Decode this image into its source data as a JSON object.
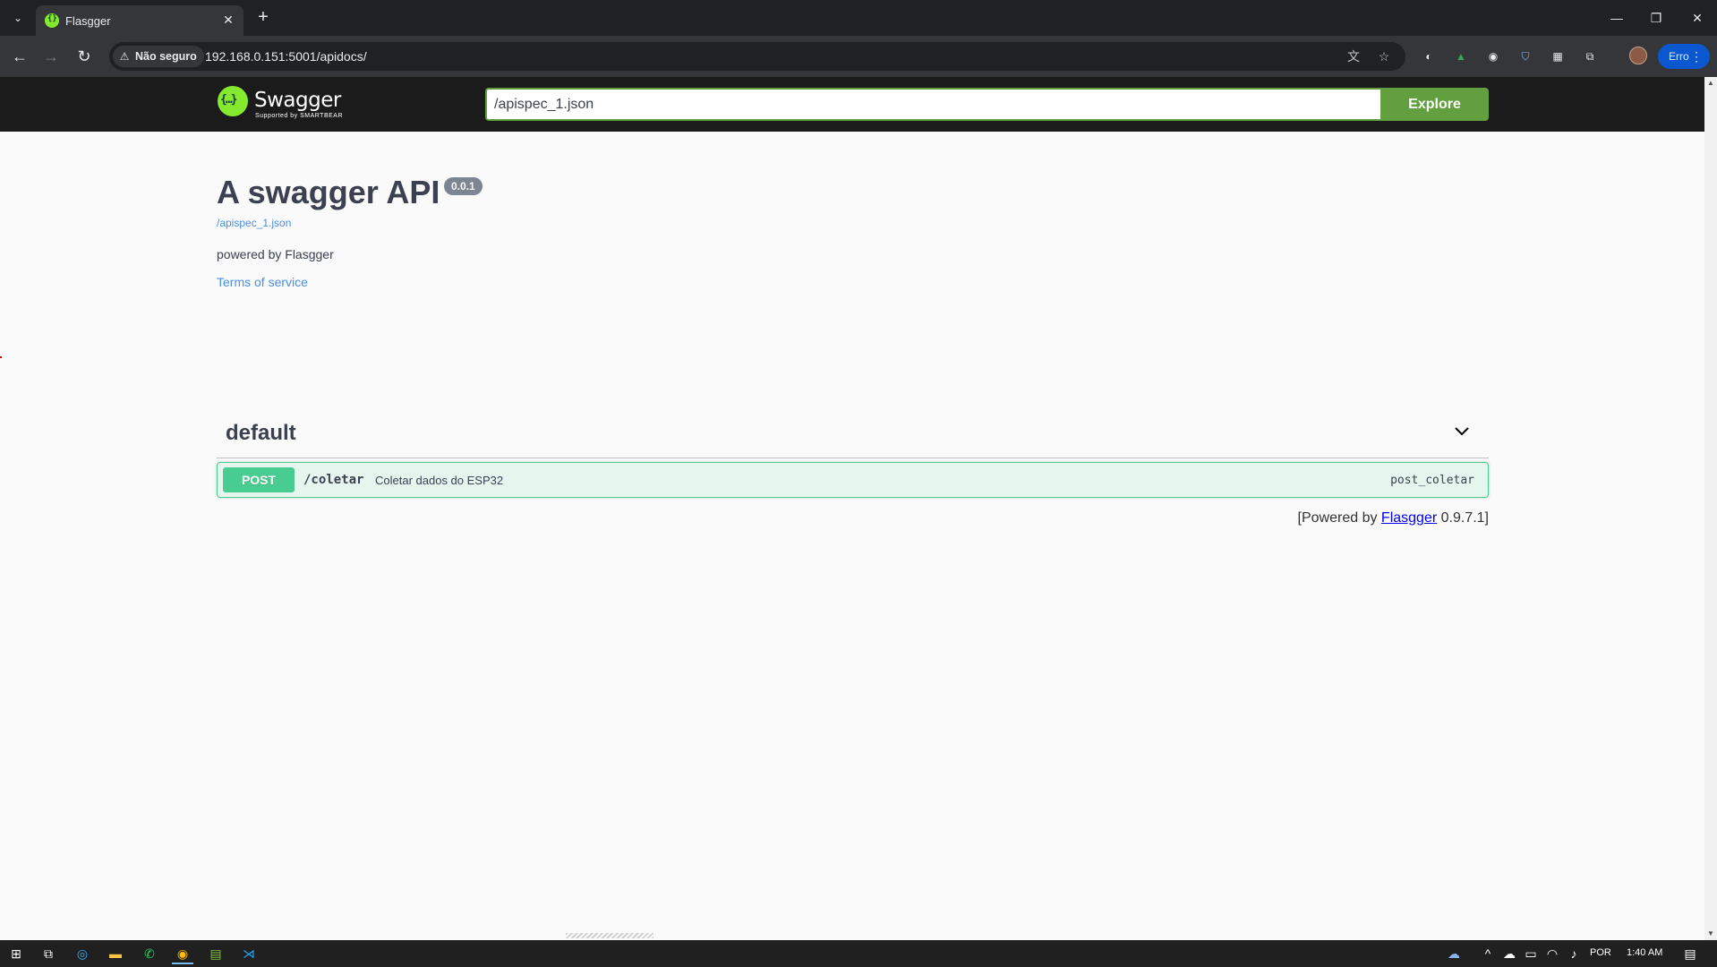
{
  "browser": {
    "tab_title": "Flasgger",
    "security_label": "Não seguro",
    "url": "192.168.0.151:5001/apidocs/",
    "error_chip_label": "Erro"
  },
  "swagger": {
    "brand": "Swagger",
    "brand_sub": "Supported by SMARTBEAR",
    "spec_url_value": "/apispec_1.json",
    "explore_label": "Explore"
  },
  "info": {
    "title": "A swagger API",
    "version": "0.0.1",
    "spec_link": "/apispec_1.json",
    "description": "powered by Flasgger",
    "terms_label": "Terms of service"
  },
  "tags": [
    {
      "name": "default",
      "operations": [
        {
          "method": "POST",
          "path": "/coletar",
          "summary": "Coletar dados do ESP32",
          "operation_id": "post_coletar"
        }
      ]
    }
  ],
  "footer": {
    "prefix": "[Powered by ",
    "link": "Flasgger",
    "suffix": " 0.9.7.1]"
  },
  "taskbar": {
    "language": "POR",
    "time": "1:40 AM"
  },
  "colors": {
    "swagger_green": "#62a03f",
    "post_green": "#49cc90",
    "link_blue": "#4990e2",
    "topbar": "#1b1b1b"
  }
}
